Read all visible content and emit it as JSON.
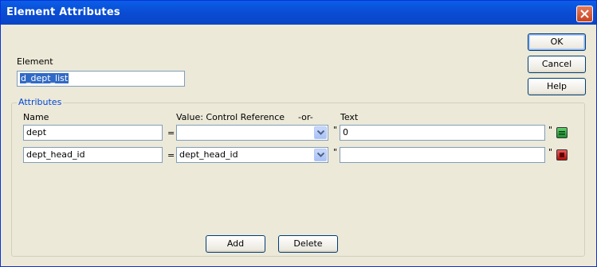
{
  "window": {
    "title": "Element Attributes"
  },
  "element": {
    "label": "Element",
    "value": "d_dept_list"
  },
  "buttons": {
    "ok": "OK",
    "cancel": "Cancel",
    "help": "Help",
    "add": "Add",
    "delete": "Delete"
  },
  "attributes": {
    "group_label": "Attributes",
    "headers": {
      "name": "Name",
      "value": "Value:  Control Reference",
      "or": "-or-",
      "text": "Text"
    },
    "equals": "=",
    "quote": "\"",
    "rows": [
      {
        "name": "dept",
        "control_reference": "",
        "text": "0",
        "action": "green-icon"
      },
      {
        "name": "dept_head_id",
        "control_reference": "dept_head_id",
        "text": "",
        "action": "red-icon"
      }
    ]
  },
  "colors": {
    "titlebar": "#0a4fd6",
    "dialog_bg": "#ece9d8",
    "group_label": "#0046d5",
    "green_button": "#2ea043",
    "red_button": "#cc1b1b"
  }
}
